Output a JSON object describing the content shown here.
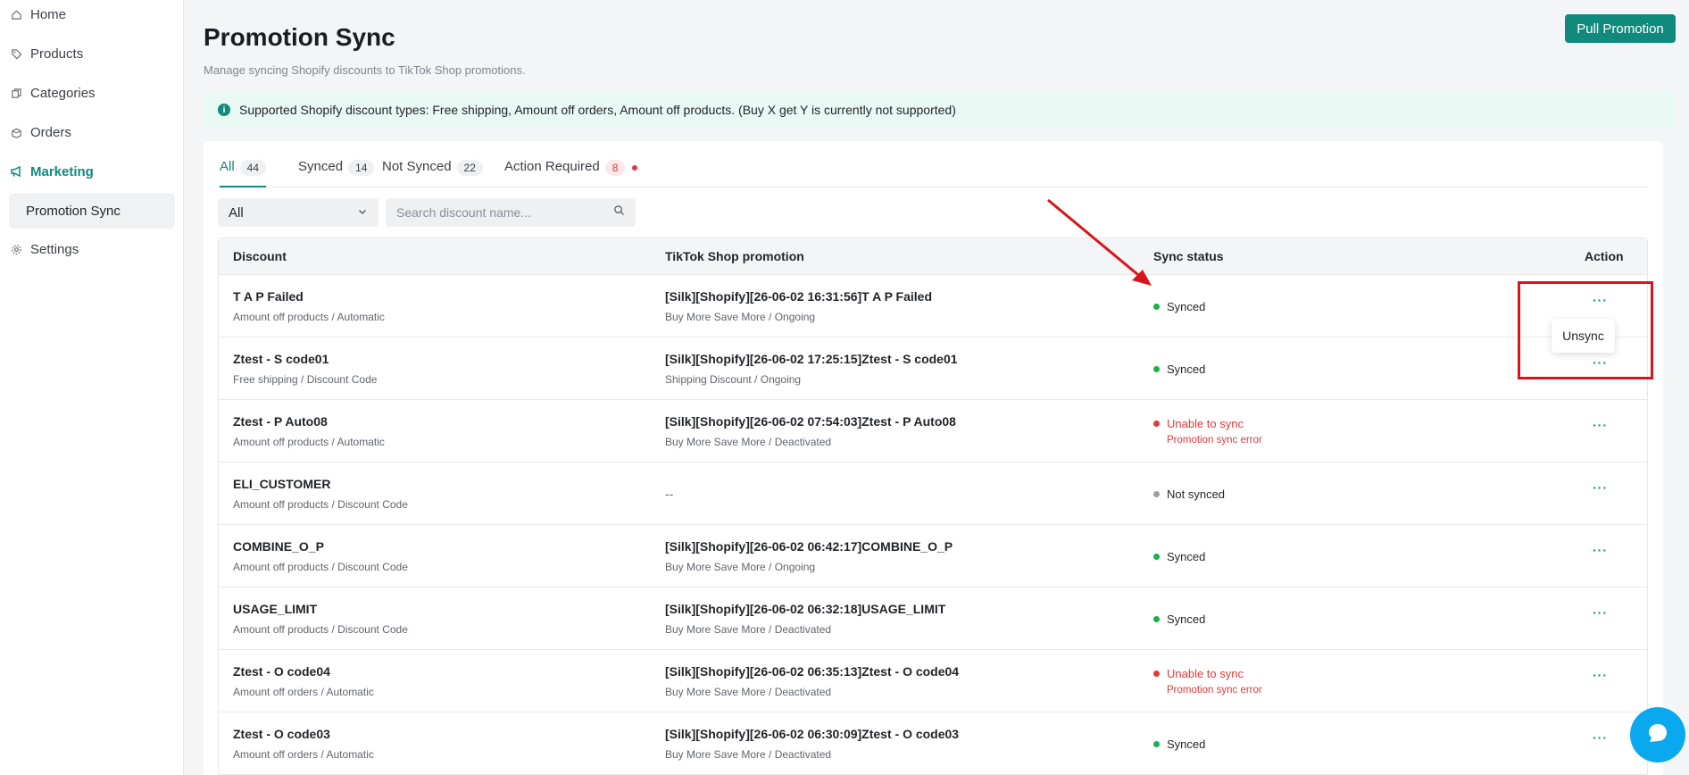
{
  "sidebar": {
    "items": [
      {
        "label": "Home",
        "icon": "home-icon"
      },
      {
        "label": "Products",
        "icon": "tag-icon"
      },
      {
        "label": "Categories",
        "icon": "copy-icon"
      },
      {
        "label": "Orders",
        "icon": "box-icon"
      },
      {
        "label": "Marketing",
        "icon": "megaphone-icon"
      },
      {
        "label": "Promotion Sync"
      },
      {
        "label": "Settings",
        "icon": "gear-icon"
      }
    ]
  },
  "header": {
    "title": "Promotion Sync",
    "subtitle": "Manage syncing Shopify discounts to TikTok Shop promotions.",
    "pull_button": "Pull Promotion"
  },
  "banner": {
    "text": "Supported Shopify discount types: Free shipping, Amount off orders, Amount off products. (Buy X get Y is currently not supported)"
  },
  "tabs": [
    {
      "label": "All",
      "count": "44"
    },
    {
      "label": "Synced",
      "count": "14"
    },
    {
      "label": "Not Synced",
      "count": "22"
    },
    {
      "label": "Action Required",
      "count": "8"
    }
  ],
  "filters": {
    "select_value": "All",
    "search_placeholder": "Search discount name..."
  },
  "table": {
    "headers": {
      "discount": "Discount",
      "promotion": "TikTok Shop promotion",
      "status": "Sync status",
      "action": "Action"
    },
    "rows": [
      {
        "name": "T A P Failed",
        "type": "Amount off products / Automatic",
        "promo": "[Silk][Shopify][26-06-02 16:31:56]T A P Failed",
        "promo_type": "Buy More Save More / Ongoing",
        "status": "Synced",
        "status_kind": "synced",
        "note": ""
      },
      {
        "name": "Ztest - S code01",
        "type": "Free shipping / Discount Code",
        "promo": "[Silk][Shopify][26-06-02 17:25:15]Ztest - S code01",
        "promo_type": "Shipping Discount / Ongoing",
        "status": "Synced",
        "status_kind": "synced",
        "note": ""
      },
      {
        "name": "Ztest - P Auto08",
        "type": "Amount off products / Automatic",
        "promo": "[Silk][Shopify][26-06-02 07:54:03]Ztest - P Auto08",
        "promo_type": "Buy More Save More / Deactivated",
        "status": "Unable to sync",
        "status_kind": "unable",
        "note": "Promotion sync error"
      },
      {
        "name": "ELI_CUSTOMER",
        "type": "Amount off products / Discount Code",
        "promo": "--",
        "promo_type": "",
        "status": "Not synced",
        "status_kind": "notsynced",
        "note": ""
      },
      {
        "name": "COMBINE_O_P",
        "type": "Amount off products / Discount Code",
        "promo": "[Silk][Shopify][26-06-02 06:42:17]COMBINE_O_P",
        "promo_type": "Buy More Save More / Ongoing",
        "status": "Synced",
        "status_kind": "synced",
        "note": ""
      },
      {
        "name": "USAGE_LIMIT",
        "type": "Amount off products / Discount Code",
        "promo": "[Silk][Shopify][26-06-02 06:32:18]USAGE_LIMIT",
        "promo_type": "Buy More Save More / Deactivated",
        "status": "Synced",
        "status_kind": "synced",
        "note": ""
      },
      {
        "name": "Ztest - O code04",
        "type": "Amount off orders / Automatic",
        "promo": "[Silk][Shopify][26-06-02 06:35:13]Ztest - O code04",
        "promo_type": "Buy More Save More / Deactivated",
        "status": "Unable to sync",
        "status_kind": "unable",
        "note": "Promotion sync error"
      },
      {
        "name": "Ztest - O code03",
        "type": "Amount off orders / Automatic",
        "promo": "[Silk][Shopify][26-06-02 06:30:09]Ztest - O code03",
        "promo_type": "Buy More Save More / Deactivated",
        "status": "Synced",
        "status_kind": "synced",
        "note": ""
      }
    ],
    "more_label": "···"
  },
  "context_menu": {
    "unsync_label": "Unsync"
  },
  "colors": {
    "accent": "#0f8a7d",
    "synced": "#1bb04b",
    "error": "#e23a3a",
    "not_synced": "#9ba1a8",
    "annotation": "#d9141a"
  }
}
